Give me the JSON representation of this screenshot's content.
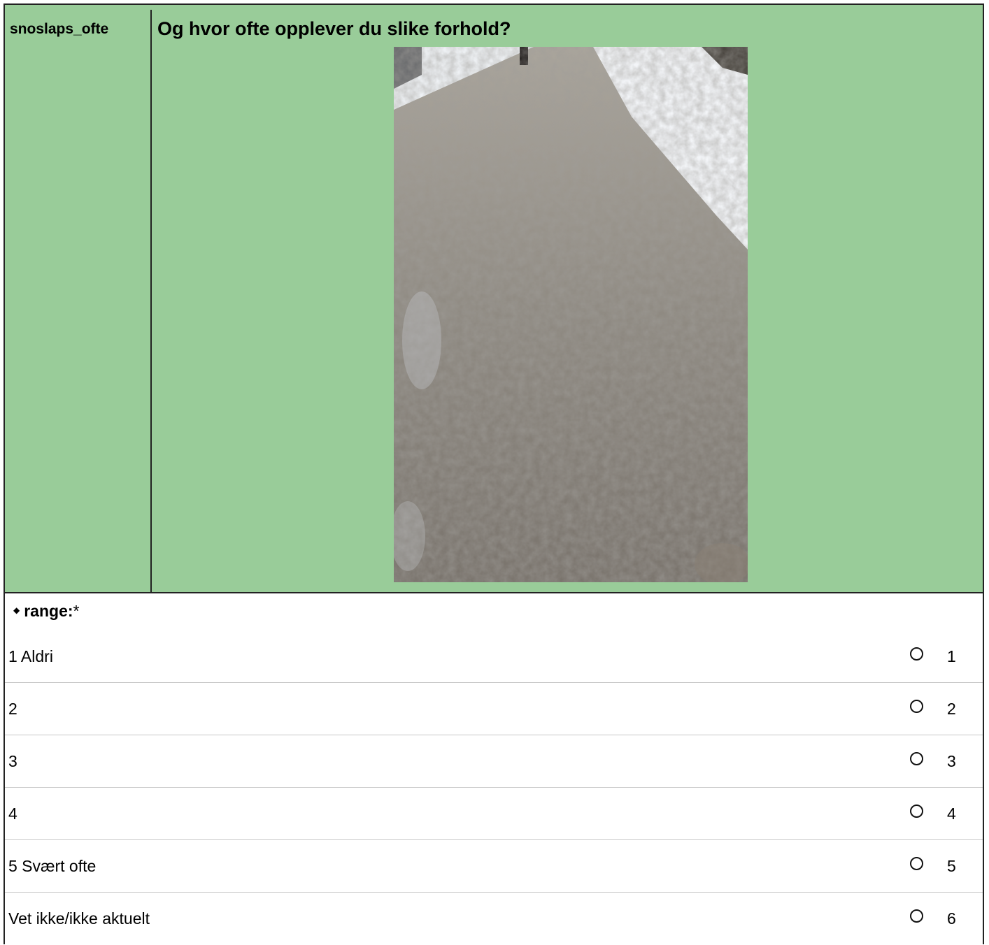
{
  "question": {
    "variable": "snoslaps_ofte",
    "text": "Og hvor ofte opplever du slike forhold?"
  },
  "range": {
    "label": "range:",
    "required_marker": "*"
  },
  "options": [
    {
      "label": "1 Aldri",
      "code": "1"
    },
    {
      "label": "2",
      "code": "2"
    },
    {
      "label": "3",
      "code": "3"
    },
    {
      "label": "4",
      "code": "4"
    },
    {
      "label": "5 Svært ofte",
      "code": "5"
    },
    {
      "label": "Vet ikke/ikke aktuelt",
      "code": "6"
    }
  ],
  "colors": {
    "header_bg": "#99cc99",
    "border": "#222222",
    "divider": "#c8c8c8"
  }
}
